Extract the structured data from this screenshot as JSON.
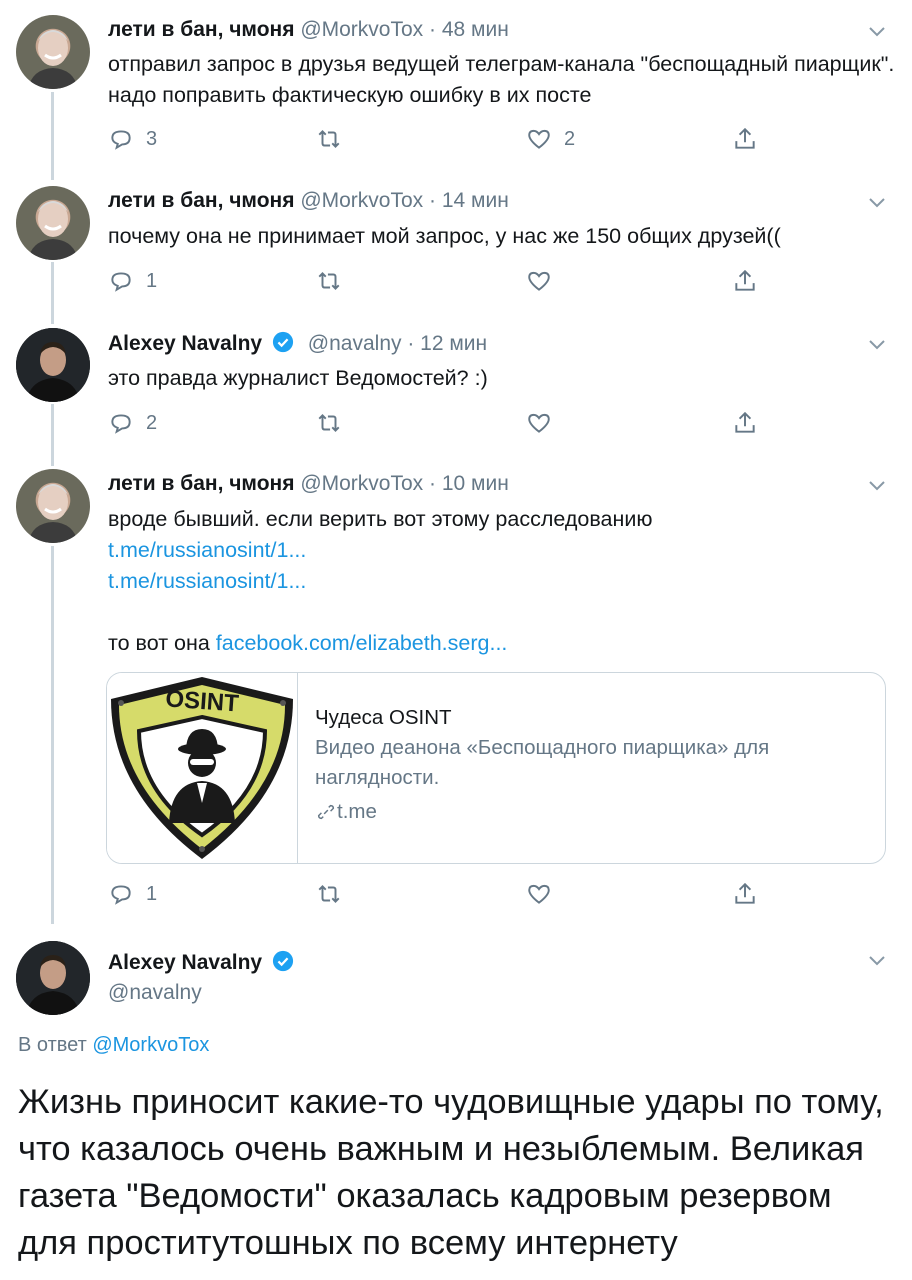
{
  "tweets": [
    {
      "name": "лети в бан, чмоня",
      "handle": "@MorkvoTox",
      "time": "· 48 мин",
      "text": "отправил запрос в друзья ведущей телеграм-канала \"беспощадный пиарщик\". надо поправить фактическую ошибку в их посте",
      "replies": "3",
      "retweets": "",
      "likes": "2"
    },
    {
      "name": "лети в бан, чмоня",
      "handle": "@MorkvoTox",
      "time": "· 14 мин",
      "text": "почему она не принимает мой запрос, у нас же 150 общих друзей((",
      "replies": "1",
      "retweets": "",
      "likes": ""
    },
    {
      "name": "Alexey Navalny",
      "handle": "@navalny",
      "time": "· 12 мин",
      "text": "это правда журналист Ведомостей? :)",
      "replies": "2",
      "retweets": "",
      "likes": ""
    },
    {
      "name": "лети в бан, чмоня",
      "handle": "@MorkvoTox",
      "time": "· 10 мин",
      "text": "вроде бывший. если верить вот этому расследованию",
      "link1": "t.me/russianosint/1...",
      "link2": "t.me/russianosint/1...",
      "text2": "то вот она",
      "link3": "facebook.com/elizabeth.serg...",
      "card": {
        "badge": "OSINT",
        "title": "Чудеса OSINT",
        "description": "Видео деанона «Беспощадного пиарщика» для наглядности.",
        "url": "t.me"
      },
      "replies": "1",
      "retweets": "",
      "likes": ""
    }
  ],
  "main_tweet": {
    "name": "Alexey Navalny",
    "handle": "@navalny",
    "reply_prefix": "В ответ",
    "reply_handle": "@MorkvoTox",
    "text": "Жизнь приносит какие-то чудовищные удары по тому, что казалось очень важным и незыблемым. Великая газета \"Ведомости\" оказалась кадровым резервом для проститутошных по всему интернету"
  },
  "colors": {
    "link": "#1b95e0",
    "secondary_text": "#657786",
    "verified": "#1da1f2",
    "thread_line": "#ccd6dd"
  },
  "icons": [
    "reply-icon",
    "retweet-icon",
    "like-icon",
    "share-icon",
    "verified-icon",
    "chevron-down-icon",
    "link-icon"
  ]
}
